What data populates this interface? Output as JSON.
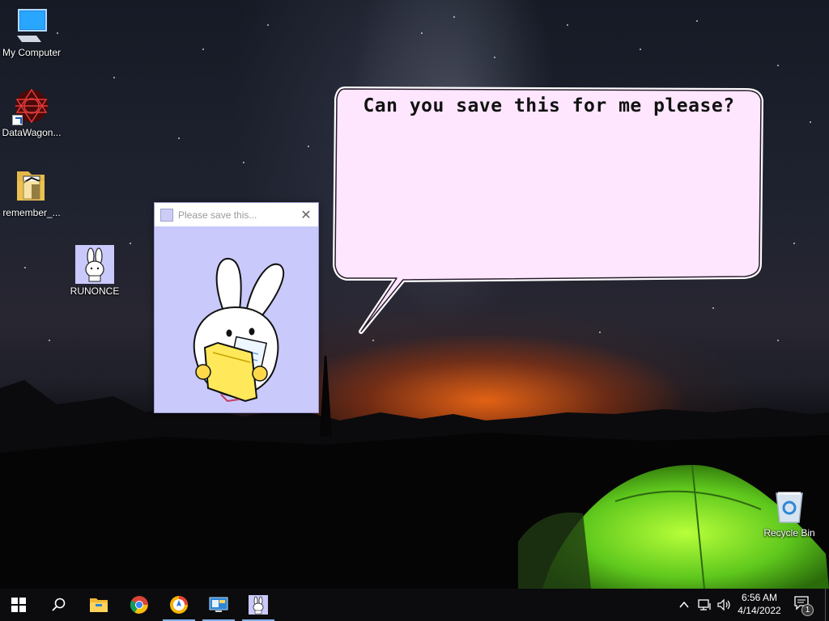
{
  "desktop": {
    "icons": [
      {
        "label": "My Computer",
        "icon": "computer-icon"
      },
      {
        "label": "DataWagon...",
        "icon": "datawagon-icon"
      },
      {
        "label": "remember_...",
        "icon": "folder-icon"
      },
      {
        "label": "RUNONCE",
        "icon": "bunny-app-icon"
      },
      {
        "label": "Recycle Bin",
        "icon": "recycle-bin-icon"
      }
    ]
  },
  "bunny_window": {
    "title": "Please save this...",
    "close_glyph": "✕",
    "background": "#c9c9fb"
  },
  "speech_bubble": {
    "text": "Can you save this for me please?",
    "fill": "#fde6fe"
  },
  "taskbar": {
    "apps": [
      "start-icon",
      "search-icon",
      "file-explorer-icon",
      "chrome-icon",
      "browser-icon",
      "remote-desktop-icon",
      "bunny-app-icon"
    ],
    "clock": {
      "time": "6:56 AM",
      "date": "4/14/2022"
    },
    "notification_count": "1"
  }
}
